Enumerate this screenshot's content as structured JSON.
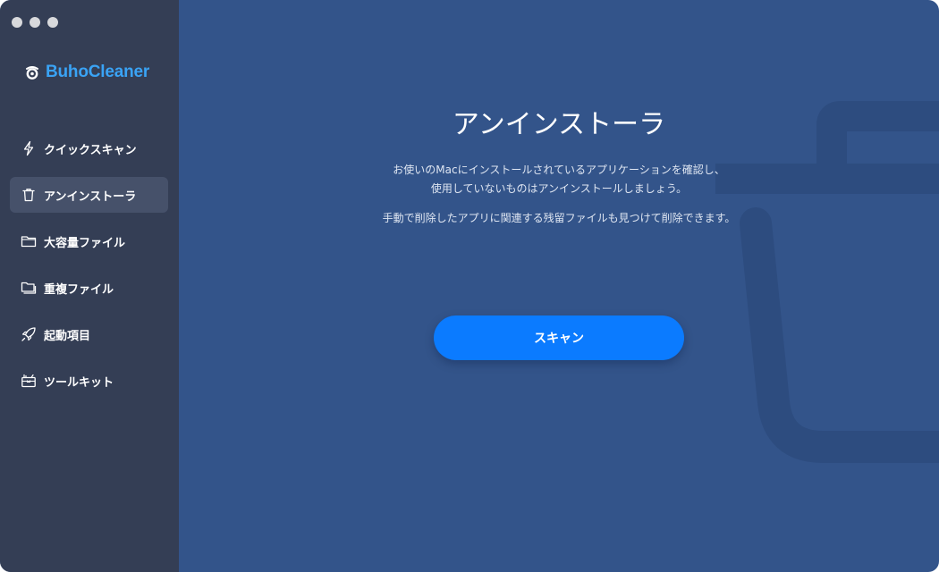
{
  "app": {
    "name": "BuhoCleaner",
    "brand_color": "#3aa3f5",
    "accent_color": "#0b7bff"
  },
  "window_controls": [
    "close",
    "minimize",
    "zoom"
  ],
  "sidebar": {
    "items": [
      {
        "label": "クイックスキャン",
        "icon": "lightning-icon",
        "active": false
      },
      {
        "label": "アンインストーラ",
        "icon": "trash-icon",
        "active": true
      },
      {
        "label": "大容量ファイル",
        "icon": "folder-icon",
        "active": false
      },
      {
        "label": "重複ファイル",
        "icon": "duplicate-folder-icon",
        "active": false
      },
      {
        "label": "起動項目",
        "icon": "rocket-icon",
        "active": false
      },
      {
        "label": "ツールキット",
        "icon": "toolbox-icon",
        "active": false
      }
    ]
  },
  "main": {
    "title": "アンインストーラ",
    "description_line1": "お使いのMacにインストールされているアプリケーションを確認し、",
    "description_line2": "使用していないものはアンインストールしましょう。",
    "description_line3": "手動で削除したアプリに関連する残留ファイルも見つけて削除できます。",
    "scan_button": "スキャン",
    "background_icon": "trash-icon"
  }
}
